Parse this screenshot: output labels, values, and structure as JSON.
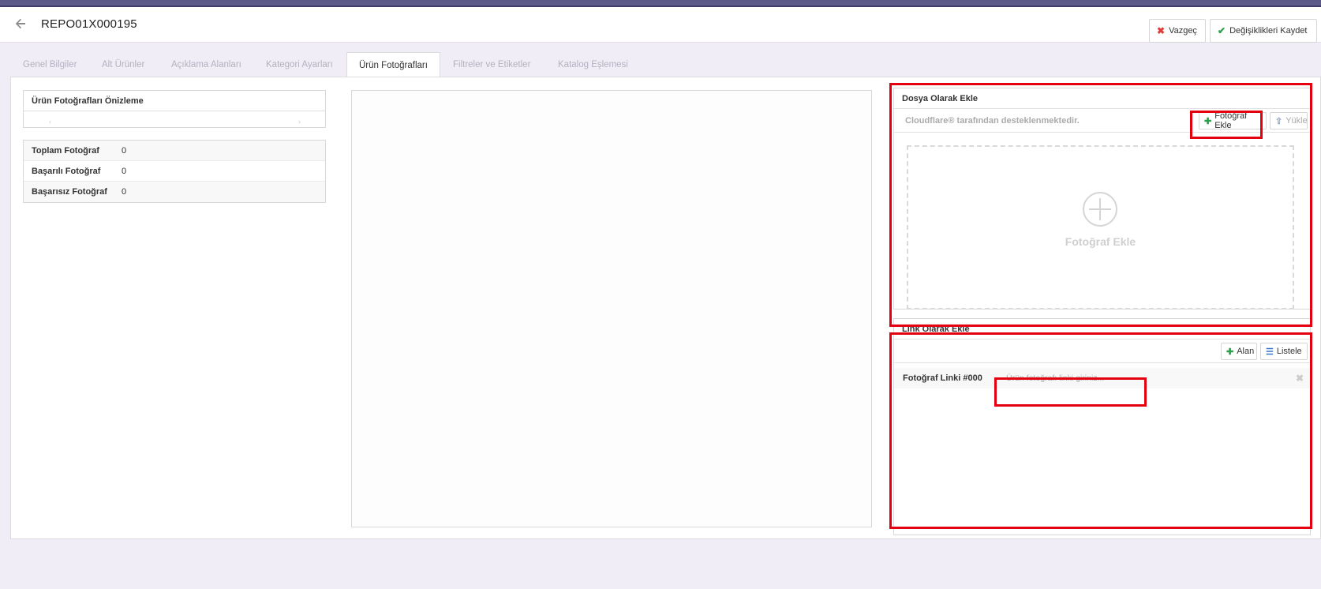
{
  "header": {
    "title": "REPO01X000195",
    "cancel_label": "Vazgeç",
    "save_label": "Değişiklikleri Kaydet"
  },
  "tabs": [
    {
      "label": "Genel Bilgiler"
    },
    {
      "label": "Alt Ürünler"
    },
    {
      "label": "Açıklama Alanları"
    },
    {
      "label": "Kategori Ayarları"
    },
    {
      "label": "Ürün Fotoğrafları",
      "active": true
    },
    {
      "label": "Filtreler ve Etiketler"
    },
    {
      "label": "Katalog Eşlemesi"
    }
  ],
  "preview": {
    "title": "Ürün Fotoğrafları Önizleme",
    "prev_glyph": "‹",
    "next_glyph": "›"
  },
  "stats": [
    {
      "label": "Toplam Fotoğraf",
      "value": "0"
    },
    {
      "label": "Başarılı Fotoğraf",
      "value": "0"
    },
    {
      "label": "Başarısız Fotoğraf",
      "value": "0"
    }
  ],
  "file_upload": {
    "title": "Dosya Olarak Ekle",
    "note": "Cloudflare® tarafından desteklenmektedir.",
    "add_photo_label": "Fotoğraf Ekle",
    "upload_label": "Yükle",
    "dropzone_label": "Fotoğraf Ekle"
  },
  "link_upload": {
    "title": "Link Olarak Ekle",
    "field_button_label": "Alan",
    "list_button_label": "Listele",
    "rows": [
      {
        "label": "Fotoğraf Linki #000",
        "placeholder": "Ürün fotoğrafı linki giriniz..."
      }
    ]
  },
  "colors": {
    "accent_top": "#5d5a8a",
    "highlight": "#e5000f",
    "page_bg": "#f1edf6",
    "cancel_icon": "#e03a3a",
    "save_icon": "#2aa04a"
  },
  "icons": {
    "back": "arrow-left-icon",
    "cancel": "close-icon",
    "save": "check-icon",
    "add": "plus-icon",
    "upload": "upload-icon",
    "list": "list-icon",
    "remove": "close-icon"
  }
}
